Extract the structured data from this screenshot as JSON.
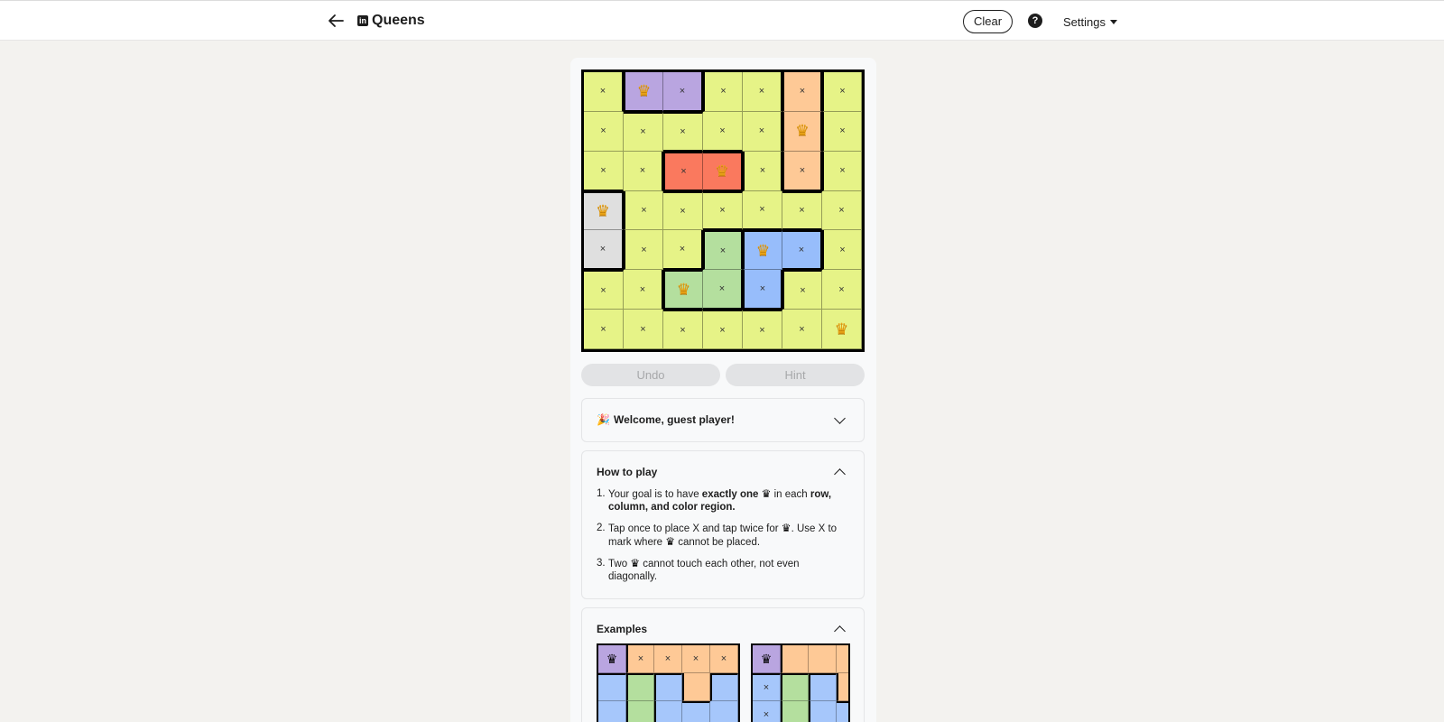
{
  "header": {
    "back_icon": "arrow-left-icon",
    "logo_text": "in",
    "title": "Queens",
    "clear_label": "Clear",
    "help_icon_text": "?",
    "settings_label": "Settings"
  },
  "board": {
    "size": 7,
    "colors": {
      "y": "#e6f387",
      "p": "#b9a5e0",
      "o": "#fec996",
      "r": "#fa795e",
      "g": "#dfdfdf",
      "gr": "#b4df9e",
      "b": "#97bdfb"
    },
    "regions": [
      [
        "y",
        "p",
        "p",
        "y",
        "y",
        "o",
        "y"
      ],
      [
        "y",
        "y",
        "y",
        "y",
        "y",
        "o",
        "y"
      ],
      [
        "y",
        "y",
        "r",
        "r",
        "y",
        "o",
        "y"
      ],
      [
        "g",
        "y",
        "y",
        "y",
        "y",
        "y",
        "y"
      ],
      [
        "g",
        "y",
        "y",
        "gr",
        "b",
        "b",
        "y"
      ],
      [
        "y",
        "y",
        "gr",
        "gr",
        "b",
        "y",
        "y"
      ],
      [
        "y",
        "y",
        "y",
        "y",
        "y",
        "y",
        "y"
      ]
    ],
    "marks": [
      [
        "x",
        "Q",
        "x",
        "x",
        "x",
        "x",
        "x"
      ],
      [
        "x",
        "x",
        "x",
        "x",
        "x",
        "Q",
        "x"
      ],
      [
        "x",
        "x",
        "x",
        "Q",
        "x",
        "x",
        "x"
      ],
      [
        "Q",
        "x",
        "x",
        "x",
        "x",
        "x",
        "x"
      ],
      [
        "x",
        "x",
        "x",
        "x",
        "Q",
        "x",
        "x"
      ],
      [
        "x",
        "x",
        "Q",
        "x",
        "x",
        "x",
        "x"
      ],
      [
        "x",
        "x",
        "x",
        "x",
        "x",
        "x",
        "Q"
      ]
    ],
    "x_symbol": "×",
    "queen_symbol": "♛"
  },
  "controls": {
    "undo_label": "Undo",
    "hint_label": "Hint"
  },
  "welcome": {
    "emoji": "🎉",
    "label": "Welcome, guest player!"
  },
  "how_to_play": {
    "title": "How to play",
    "rules": [
      {
        "num": "1.",
        "parts": [
          "Your goal is to have ",
          "exactly one",
          " in each ",
          "row, column, and color region."
        ]
      },
      {
        "num": "2.",
        "parts": [
          "Tap once to place X and tap twice for ",
          ". Use X to mark where ",
          " cannot be placed."
        ]
      },
      {
        "num": "3.",
        "parts": [
          "Two ",
          " cannot touch each other, not even diagonally."
        ]
      }
    ]
  },
  "examples": {
    "title": "Examples",
    "example1": {
      "regions": [
        [
          "p",
          "o",
          "o",
          "o",
          "o"
        ],
        [
          "b",
          "gr",
          "b",
          "o",
          "b"
        ],
        [
          "b",
          "gr",
          "b",
          "b",
          "b"
        ]
      ],
      "marks": [
        [
          "Q",
          "x",
          "x",
          "x",
          "x"
        ],
        [
          "",
          "",
          "",
          "",
          ""
        ],
        [
          "",
          "",
          "",
          "",
          ""
        ]
      ]
    },
    "example2": {
      "regions": [
        [
          "p",
          "o",
          "o",
          "o"
        ],
        [
          "b",
          "gr",
          "b",
          "o"
        ],
        [
          "b",
          "gr",
          "b",
          "b"
        ]
      ],
      "marks": [
        [
          "Q",
          "",
          "",
          ""
        ],
        [
          "x",
          "",
          "",
          ""
        ],
        [
          "x",
          "",
          "",
          ""
        ]
      ]
    }
  }
}
